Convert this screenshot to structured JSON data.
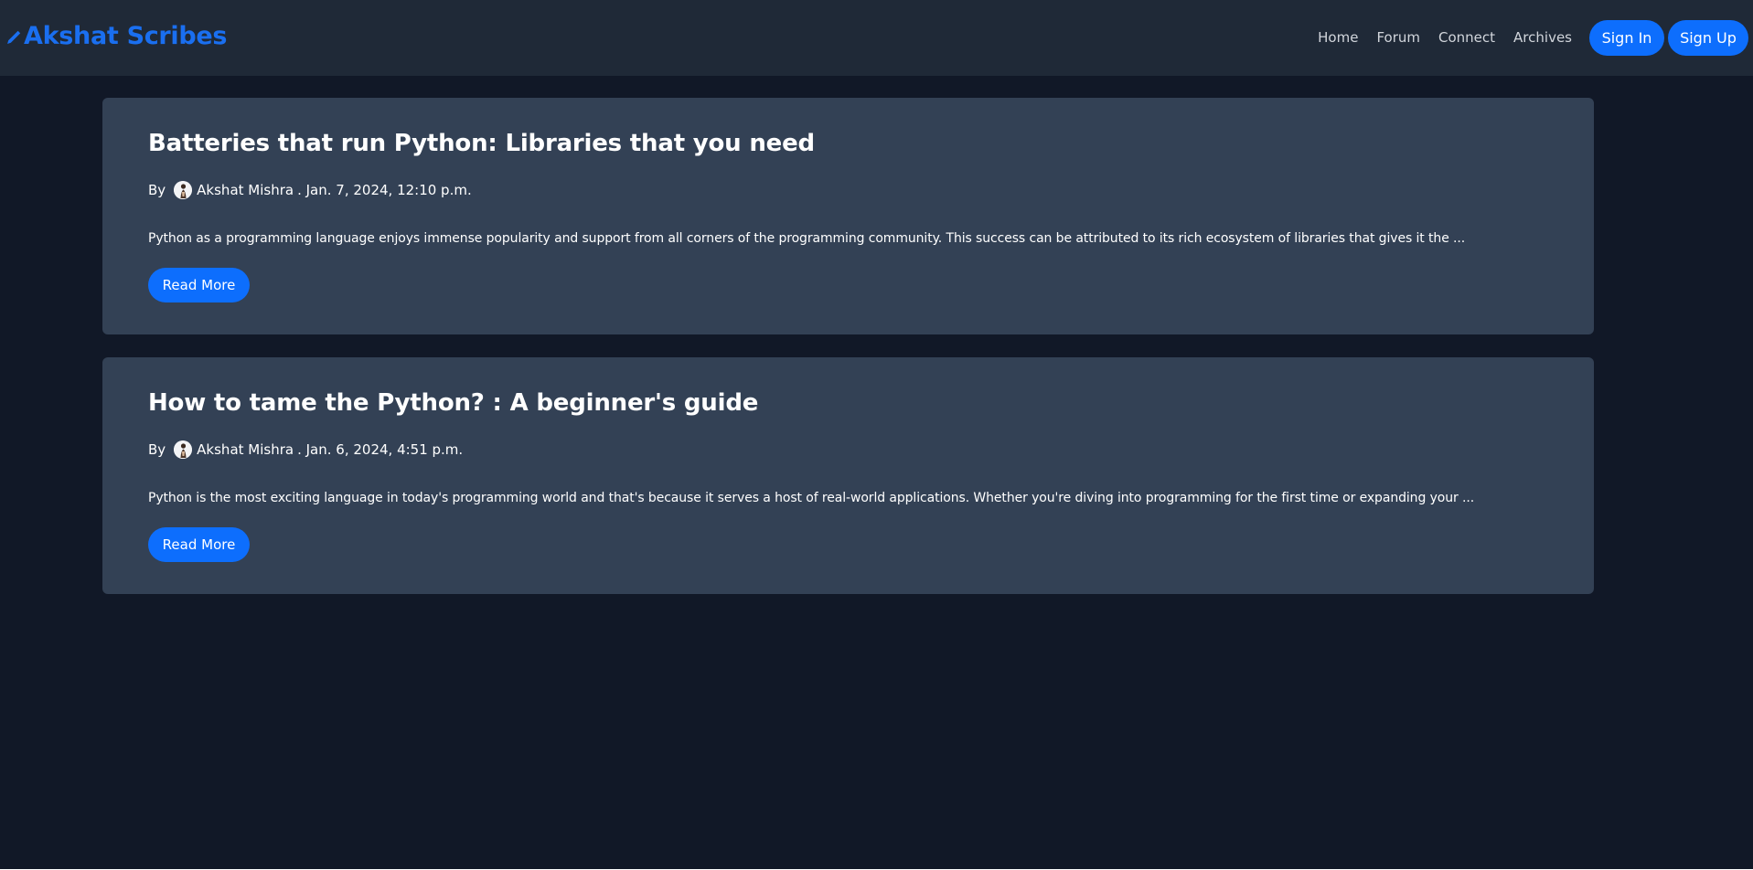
{
  "navbar": {
    "brand": "Akshat Scribes",
    "brand_icon": "pencil-icon",
    "links": [
      {
        "label": "Home"
      },
      {
        "label": "Forum"
      },
      {
        "label": "Connect"
      },
      {
        "label": "Archives"
      }
    ],
    "sign_in_label": "Sign In",
    "sign_up_label": "Sign Up"
  },
  "posts": [
    {
      "title": "Batteries that run Python: Libraries that you need",
      "by_label": "By",
      "author": "Akshat Mishra",
      "date": ". Jan. 7, 2024, 12:10 p.m.",
      "excerpt": "Python as a programming language enjoys immense popularity and support from all corners of the programming community. This success can be attributed to its rich ecosystem of libraries that gives it the ...",
      "read_more_label": "Read More"
    },
    {
      "title": "How to tame the Python? : A beginner's guide",
      "by_label": "By",
      "author": "Akshat Mishra",
      "date": ". Jan. 6, 2024, 4:51 p.m.",
      "excerpt": "Python is the most exciting language in today's programming world and that's because it serves a host of real-world applications. Whether you're diving into programming for the first time or expanding your ...",
      "read_more_label": "Read More"
    }
  ],
  "colors": {
    "page_bg": "#111827",
    "navbar_bg": "#1f2937",
    "card_bg": "#334155",
    "accent": "#0d6efd",
    "brand": "#1a6ff0"
  }
}
